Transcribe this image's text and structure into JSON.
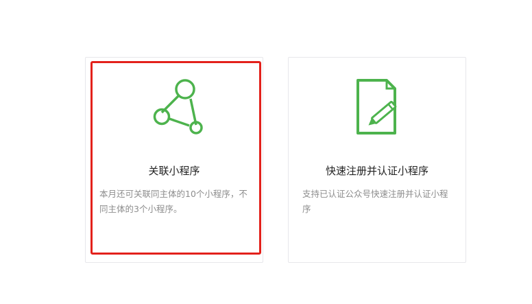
{
  "cards": [
    {
      "title": "关联小程序",
      "description": "本月还可关联同主体的10个小程序，不同主体的3个小程序。",
      "icon": "network-nodes-icon",
      "selected": true
    },
    {
      "title": "快速注册并认证小程序",
      "description": "支持已认证公众号快速注册并认证小程序",
      "icon": "document-pen-icon",
      "selected": false
    }
  ],
  "colors": {
    "icon_green": "#4db34d",
    "highlight_red": "#e3211b",
    "title_text": "#222222",
    "desc_text": "#8d8d8d",
    "card_border": "#e7e7eb"
  }
}
